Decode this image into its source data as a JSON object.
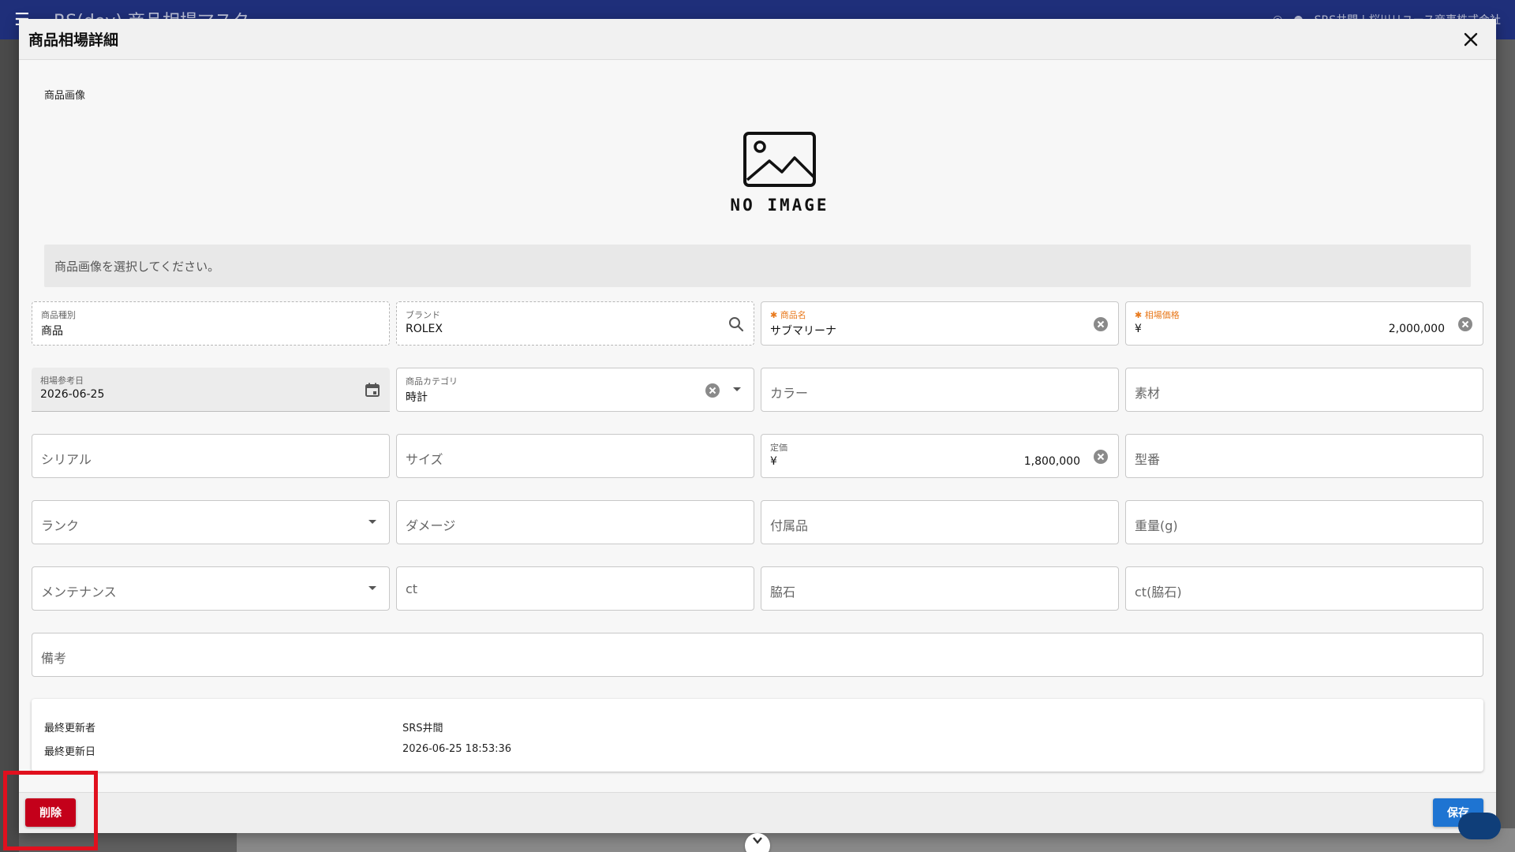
{
  "app": {
    "title": "RS(dev) 商品相場マスタ",
    "user": "SRS井間 | 桜川リユース商事株式会社"
  },
  "modal": {
    "title": "商品相場詳細",
    "image_label": "商品画像",
    "no_image_text": "NO IMAGE",
    "image_hint": "商品画像を選択してください。"
  },
  "fields": {
    "product_type": {
      "label": "商品種別",
      "value": "商品"
    },
    "brand": {
      "label": "ブランド",
      "value": "ROLEX"
    },
    "product_name": {
      "label": "商品名",
      "value": "サブマリーナ",
      "required": true
    },
    "market_price": {
      "label": "相場価格",
      "currency": "¥",
      "value": "2,000,000",
      "required": true
    },
    "reference_date": {
      "label": "相場参考日",
      "value": "2026-06-25"
    },
    "category": {
      "label": "商品カテゴリ",
      "value": "時計"
    },
    "color": {
      "placeholder": "カラー"
    },
    "material": {
      "placeholder": "素材"
    },
    "serial": {
      "placeholder": "シリアル"
    },
    "size": {
      "placeholder": "サイズ"
    },
    "list_price": {
      "label": "定価",
      "currency": "¥",
      "value": "1,800,000"
    },
    "model_number": {
      "placeholder": "型番"
    },
    "rank": {
      "placeholder": "ランク"
    },
    "damage": {
      "placeholder": "ダメージ"
    },
    "accessories": {
      "placeholder": "付属品"
    },
    "weight": {
      "placeholder": "重量(g)"
    },
    "maintenance": {
      "placeholder": "メンテナンス"
    },
    "ct": {
      "placeholder": "ct"
    },
    "side_stone": {
      "placeholder": "脇石"
    },
    "ct_side_stone": {
      "placeholder": "ct(脇石)"
    },
    "remarks": {
      "placeholder": "備考"
    }
  },
  "info": {
    "last_updated_by_label": "最終更新者",
    "last_updated_by": "SRS井間",
    "last_updated_at_label": "最終更新日",
    "last_updated_at": "2026-06-25 18:53:36"
  },
  "footer": {
    "delete_label": "削除",
    "save_label": "保存"
  },
  "colors": {
    "appbar": "#1f2f7a",
    "required": "#e8791c",
    "delete": "#c4001a",
    "save": "#1e74d2",
    "highlight": "#e0101e"
  }
}
